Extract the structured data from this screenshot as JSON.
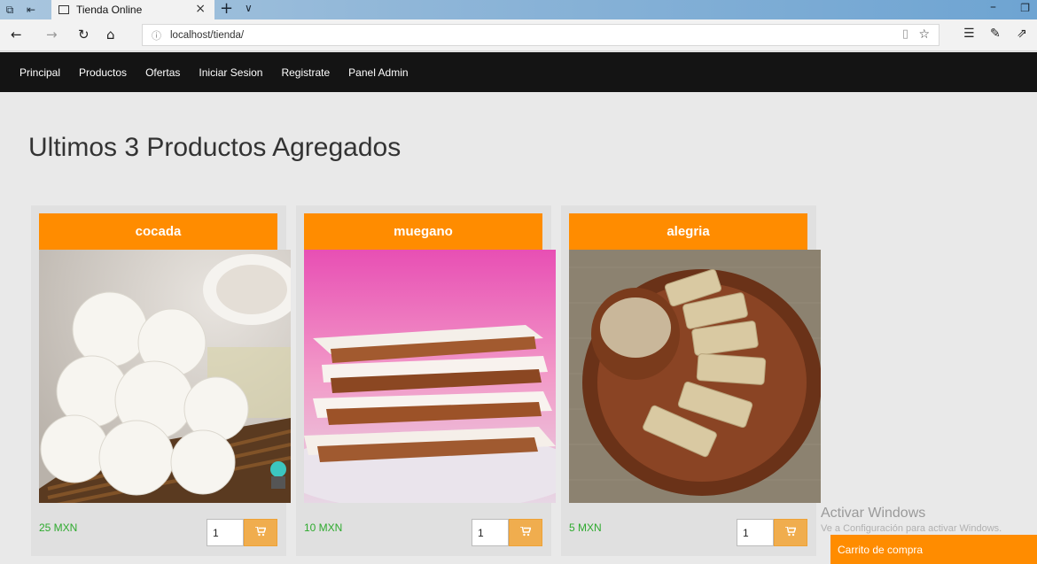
{
  "browser": {
    "tab_title": "Tienda Online",
    "url": "localhost/tienda/"
  },
  "nav": {
    "items": [
      "Principal",
      "Productos",
      "Ofertas",
      "Iniciar Sesion",
      "Registrate",
      "Panel Admin"
    ]
  },
  "page": {
    "heading": "Ultimos 3 Productos Agregados"
  },
  "products": [
    {
      "name": "cocada",
      "price": "25 MXN",
      "quantity": "1"
    },
    {
      "name": "muegano",
      "price": "10 MXN",
      "quantity": "1"
    },
    {
      "name": "alegria",
      "price": "5 MXN",
      "quantity": "1"
    }
  ],
  "watermark": {
    "line1": "Activar Windows",
    "line2": "Ve a Configuración para activar Windows."
  },
  "cart": {
    "label": "Carrito de compra"
  },
  "colors": {
    "accent": "#ff8c00",
    "cart_button": "#f0ad4e",
    "price": "#2eaa2e",
    "navbar": "#141414"
  }
}
